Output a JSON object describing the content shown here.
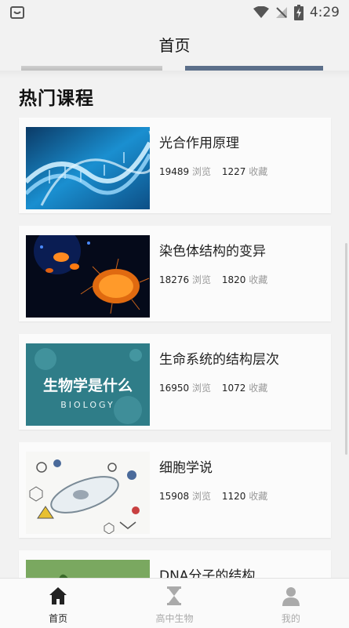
{
  "status_bar": {
    "time": "4:29"
  },
  "header": {
    "title": "首页"
  },
  "section": {
    "title": "热门课程"
  },
  "courses": [
    {
      "title": "光合作用原理",
      "views": "19489",
      "views_label": "浏览",
      "favorites": "1227",
      "favorites_label": "收藏"
    },
    {
      "title": "染色体结构的变异",
      "views": "18276",
      "views_label": "浏览",
      "favorites": "1820",
      "favorites_label": "收藏"
    },
    {
      "title": "生命系统的结构层次",
      "views": "16950",
      "views_label": "浏览",
      "favorites": "1072",
      "favorites_label": "收藏",
      "thumb_text": "生物学是什么",
      "thumb_subtext": "BIOLOGY"
    },
    {
      "title": "细胞学说",
      "views": "15908",
      "views_label": "浏览",
      "favorites": "1120",
      "favorites_label": "收藏"
    },
    {
      "title": "DNA分子的结构"
    }
  ],
  "bottom_nav": [
    {
      "label": "首页",
      "icon": "home-icon",
      "active": true
    },
    {
      "label": "高中生物",
      "icon": "hourglass-icon",
      "active": false
    },
    {
      "label": "我的",
      "icon": "user-icon",
      "active": false
    }
  ],
  "colors": {
    "accent_strip": "#5c6f8a",
    "active_nav": "#222222",
    "inactive_nav": "#aaaaaa"
  }
}
